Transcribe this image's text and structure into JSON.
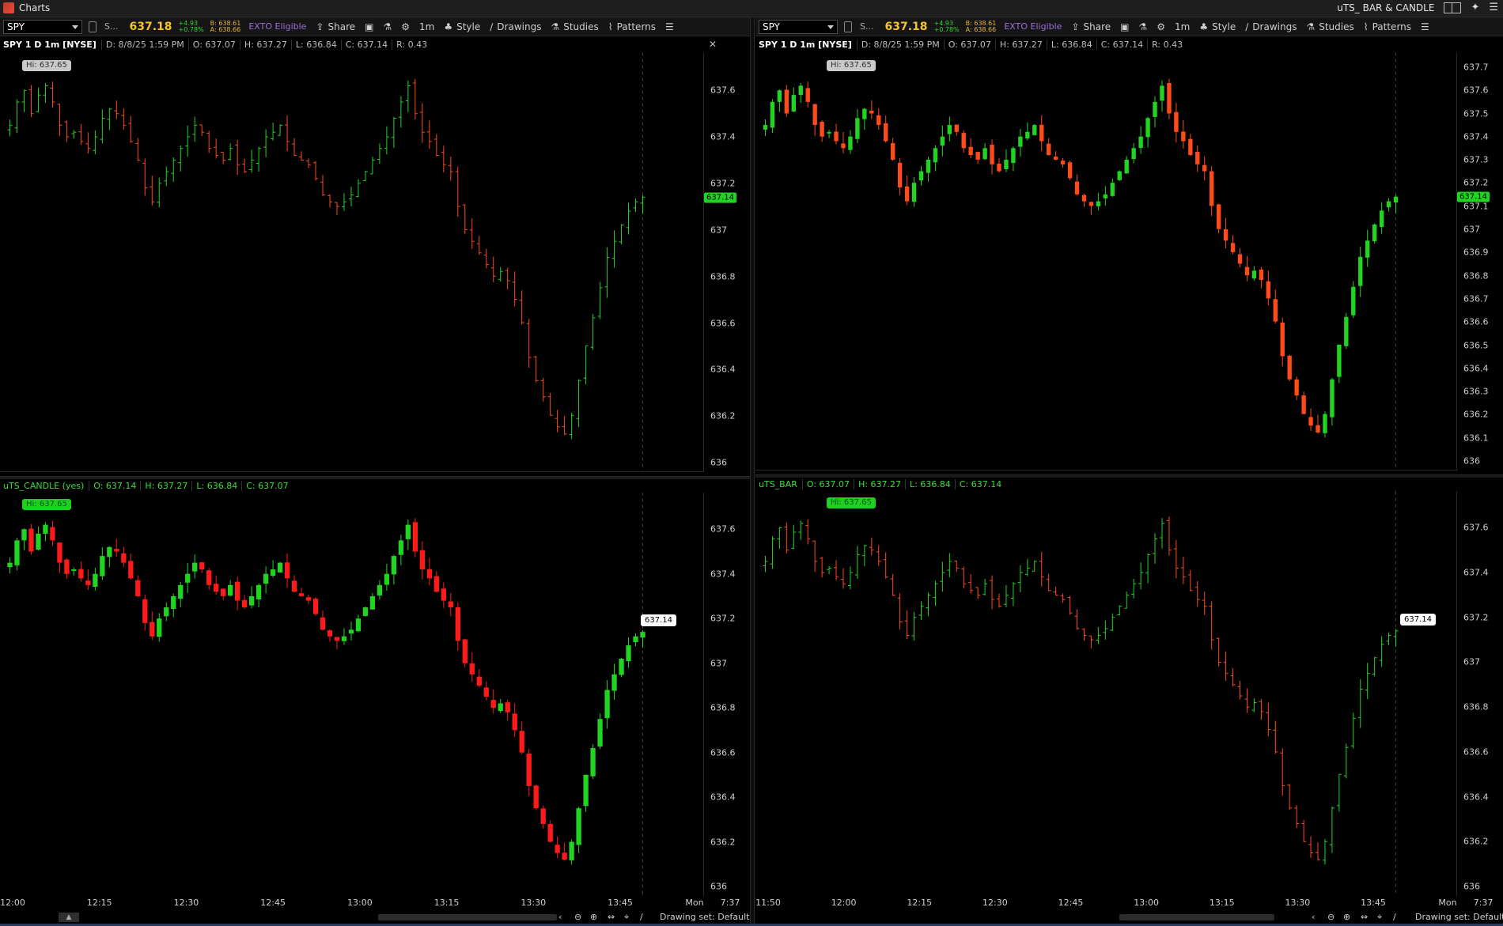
{
  "window": {
    "title": "Charts",
    "layout_name": "uTS_ BAR & CANDLE"
  },
  "panes": [
    {
      "symbol": "SPY",
      "symbol_short": "S...",
      "last": "637.18",
      "change": "+4.93",
      "change_pct": "+0.78%",
      "bid": "B: 638.61",
      "ask": "A: 638.66",
      "exto": "EXTO Eligible",
      "buttons": {
        "share": "Share",
        "timeframe": "1m",
        "style": "Style",
        "drawings": "Drawings",
        "studies": "Studies",
        "patterns": "Patterns"
      }
    },
    {
      "symbol": "SPY",
      "symbol_short": "S...",
      "last": "637.18",
      "change": "+4.93",
      "change_pct": "+0.78%",
      "bid": "B: 638.61",
      "ask": "A: 638.66",
      "exto": "EXTO Eligible",
      "buttons": {
        "share": "Share",
        "timeframe": "1m",
        "style": "Style",
        "drawings": "Drawings",
        "studies": "Studies",
        "patterns": "Patterns"
      }
    }
  ],
  "charts": {
    "left_top": {
      "title": "SPY 1 D 1m [NYSE]",
      "date": "D: 8/8/25 1:59 PM",
      "open": "O: 637.07",
      "high": "H: 637.27",
      "low": "L: 636.84",
      "close": "C: 637.14",
      "range": "R: 0.43",
      "hi_badge": "Hi: 637.65",
      "price_tag": "637.14",
      "yticks": [
        "637.6",
        "637.4",
        "637.2",
        "637",
        "636.8",
        "636.6",
        "636.4",
        "636.2",
        "636"
      ]
    },
    "right_top": {
      "title": "SPY 1 D 1m [NYSE]",
      "date": "D: 8/8/25 1:59 PM",
      "open": "O: 637.07",
      "high": "H: 637.27",
      "low": "L: 636.84",
      "close": "C: 637.14",
      "range": "R: 0.43",
      "hi_badge": "Hi: 637.65",
      "price_tag": "637.14",
      "yticks": [
        "637.7",
        "637.6",
        "637.5",
        "637.4",
        "637.3",
        "637.2",
        "637.1",
        "637",
        "636.9",
        "636.8",
        "636.7",
        "636.6",
        "636.5",
        "636.4",
        "636.3",
        "636.2",
        "636.1",
        "636"
      ]
    },
    "left_bottom": {
      "title": "uTS_CANDLE (yes)",
      "open": "O: 637.14",
      "high": "H: 637.27",
      "low": "L: 636.84",
      "close": "C: 637.07",
      "hi_badge": "Hi: 637.65",
      "last_badge": "637.14",
      "yticks": [
        "637.6",
        "637.4",
        "637.2",
        "637",
        "636.8",
        "636.6",
        "636.4",
        "636.2",
        "636"
      ]
    },
    "right_bottom": {
      "title": "uTS_BAR",
      "open": "O: 637.07",
      "high": "H: 637.27",
      "low": "L: 636.84",
      "close": "C: 637.14",
      "hi_badge": "Hi: 637.65",
      "last_badge": "637.14",
      "yticks": [
        "637.6",
        "637.4",
        "637.2",
        "637",
        "636.8",
        "636.6",
        "636.4",
        "636.2",
        "636"
      ]
    }
  },
  "xaxis_left": [
    "12:00",
    "12:15",
    "12:30",
    "12:45",
    "13:00",
    "13:15",
    "13:30",
    "13:45",
    "Mon",
    "7:37"
  ],
  "xaxis_right": [
    "11:50",
    "12:00",
    "12:15",
    "12:30",
    "12:45",
    "13:00",
    "13:15",
    "13:30",
    "13:45",
    "Mon",
    "7:37"
  ],
  "footer": {
    "drawing_set": "Drawing set: Default"
  },
  "colors": {
    "up": "#21d421",
    "down": "#ff4a1a",
    "down_bright": "#ff1a1a",
    "background": "#000000",
    "last_price": "#f4c430",
    "exto": "#9b6fdc"
  },
  "chart_data": {
    "type": "candlestick",
    "symbol": "SPY",
    "interval": "1m",
    "session_date": "8/8/25",
    "ylim": [
      636.0,
      637.7
    ],
    "session_high": 637.65,
    "last": 637.14,
    "close_path": [
      637.45,
      637.55,
      637.6,
      637.5,
      637.58,
      637.62,
      637.55,
      637.45,
      637.4,
      637.42,
      637.38,
      637.35,
      637.4,
      637.48,
      637.52,
      637.5,
      637.45,
      637.38,
      637.3,
      637.18,
      637.12,
      637.2,
      637.25,
      637.3,
      637.35,
      637.4,
      637.45,
      637.42,
      637.35,
      637.32,
      637.3,
      637.35,
      637.28,
      637.25,
      637.3,
      637.35,
      637.4,
      637.42,
      637.45,
      637.38,
      637.32,
      637.3,
      637.28,
      637.22,
      637.15,
      637.12,
      637.1,
      637.12,
      637.15,
      637.2,
      637.25,
      637.3,
      637.35,
      637.4,
      637.48,
      637.55,
      637.62,
      637.5,
      637.42,
      637.38,
      637.32,
      637.28,
      637.25,
      637.1,
      637.0,
      636.95,
      636.9,
      636.85,
      636.8,
      636.82,
      636.78,
      636.7,
      636.6,
      636.45,
      636.35,
      636.28,
      636.2,
      636.15,
      636.12,
      636.2,
      636.35,
      636.5,
      636.62,
      636.75,
      636.88,
      636.95,
      637.02,
      637.08,
      637.12,
      637.14
    ]
  }
}
